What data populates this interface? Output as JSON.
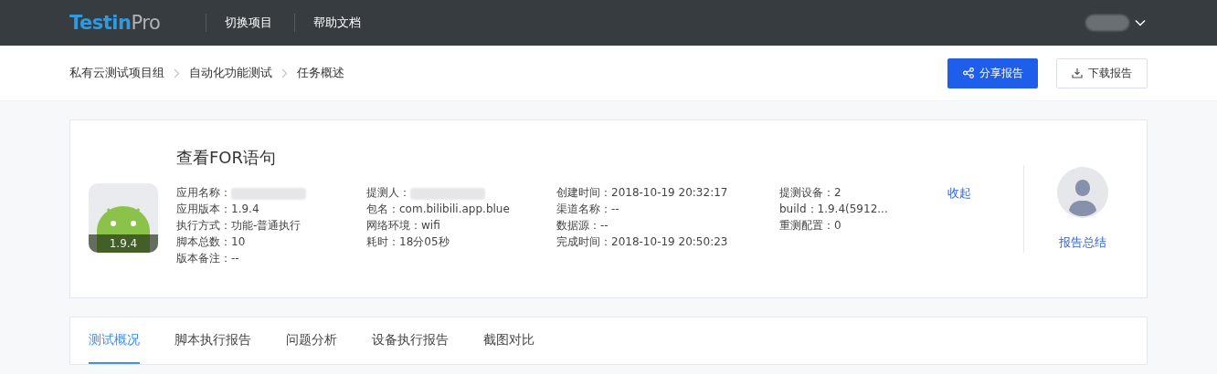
{
  "header": {
    "logo_main": "Testin",
    "logo_suffix": "Pro",
    "nav": [
      "切换项目",
      "帮助文档"
    ]
  },
  "breadcrumb": [
    "私有云测试项目组",
    "自动化功能测试",
    "任务概述"
  ],
  "actions": [
    {
      "kind": "primary",
      "label": "分享报告"
    },
    {
      "kind": "secondary",
      "label": "下载报告"
    }
  ],
  "task": {
    "title": "查看FOR语句",
    "app_version_badge": "1.9.4",
    "collapse_link": "收起",
    "summary_link": "报告总结",
    "columns": [
      [
        {
          "kind": "redacted",
          "text": "应用名称："
        },
        {
          "kind": "text",
          "text": "应用版本：1.9.4"
        },
        {
          "kind": "text",
          "text": "执行方式：功能-普通执行"
        },
        {
          "kind": "text",
          "text": "脚本总数：10"
        },
        {
          "kind": "text",
          "text": "版本备注：--"
        }
      ],
      [
        {
          "kind": "redacted",
          "text": "提测人："
        },
        {
          "kind": "text",
          "text": "包名：com.bilibili.app.blue"
        },
        {
          "kind": "text",
          "text": "网络环境：wifi"
        },
        {
          "kind": "text",
          "text": "耗时：18分05秒"
        }
      ],
      [
        {
          "kind": "text",
          "text": "创建时间：2018-10-19 20:32:17"
        },
        {
          "kind": "text",
          "text": "渠道名称：--"
        },
        {
          "kind": "text",
          "text": "数据源：--"
        },
        {
          "kind": "text",
          "text": "完成时间：2018-10-19 20:50:23"
        }
      ],
      [
        {
          "kind": "text",
          "text": "提测设备：2"
        },
        {
          "kind": "text",
          "text": "build：1.9.4(5912..."
        },
        {
          "kind": "text",
          "text": "重测配置：0"
        }
      ]
    ]
  },
  "tabs": [
    {
      "label": "测试概况",
      "selected": true
    },
    {
      "label": "脚本执行报告",
      "selected": false
    },
    {
      "label": "问题分析",
      "selected": false
    },
    {
      "label": "设备执行报告",
      "selected": false
    },
    {
      "label": "截图对比",
      "selected": false
    }
  ]
}
